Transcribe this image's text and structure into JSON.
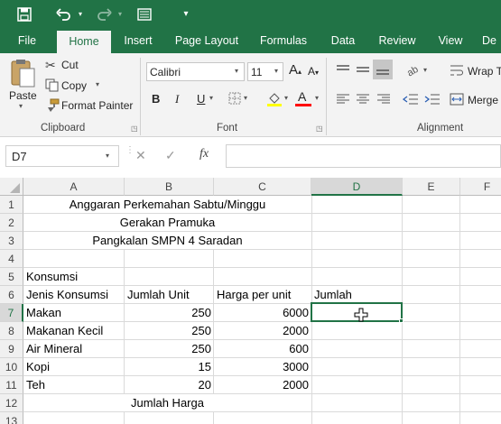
{
  "colors": {
    "brand": "#217346",
    "ribbon_bg": "#f3f3f3",
    "selection": "#217346"
  },
  "tabs": [
    "File",
    "Home",
    "Insert",
    "Page Layout",
    "Formulas",
    "Data",
    "Review",
    "View",
    "De"
  ],
  "active_tab": "Home",
  "clipboard": {
    "paste": "Paste",
    "cut": "Cut",
    "copy": "Copy",
    "format_painter": "Format Painter",
    "group": "Clipboard"
  },
  "font": {
    "name": "Calibri",
    "size": "11",
    "group": "Font",
    "bold": "B",
    "italic": "I",
    "underline": "U",
    "font_color_label": "A"
  },
  "alignment": {
    "wrap": "Wrap T",
    "merge": "Merge",
    "group": "Alignment"
  },
  "formula_bar": {
    "name_box": "D7",
    "fx": "fx",
    "formula": ""
  },
  "columns": [
    "A",
    "B",
    "C",
    "D",
    "E",
    "F"
  ],
  "selected_column": "D",
  "rows": [
    "1",
    "2",
    "3",
    "4",
    "5",
    "6",
    "7",
    "8",
    "9",
    "10",
    "11",
    "12",
    "13"
  ],
  "selected_row": "7",
  "sheet": {
    "title1": "Anggaran Perkemahan Sabtu/Minggu",
    "title2": "Gerakan Pramuka",
    "title3": "Pangkalan SMPN 4 Saradan",
    "section": "Konsumsi",
    "headers": [
      "Jenis Konsumsi",
      "Jumlah Unit",
      "Harga per unit",
      "Jumlah"
    ],
    "items": [
      {
        "name": "Makan",
        "unit": "250",
        "price": "6000"
      },
      {
        "name": "Makanan Kecil",
        "unit": "250",
        "price": "2000"
      },
      {
        "name": "Air Mineral",
        "unit": "250",
        "price": "600"
      },
      {
        "name": "Kopi",
        "unit": "15",
        "price": "3000"
      },
      {
        "name": "Teh",
        "unit": "20",
        "price": "2000"
      }
    ],
    "total_label": "Jumlah Harga"
  },
  "icons": [
    "save-icon",
    "undo-icon",
    "redo-icon",
    "form-icon",
    "customize-qat-icon",
    "cut-icon",
    "copy-icon",
    "format-painter-icon",
    "paste-icon",
    "borders-icon",
    "fill-color-icon",
    "font-color-icon",
    "orientation-icon",
    "wrap-text-icon",
    "merge-icon",
    "cancel-icon",
    "enter-icon",
    "fx-icon",
    "cursor-icon"
  ]
}
